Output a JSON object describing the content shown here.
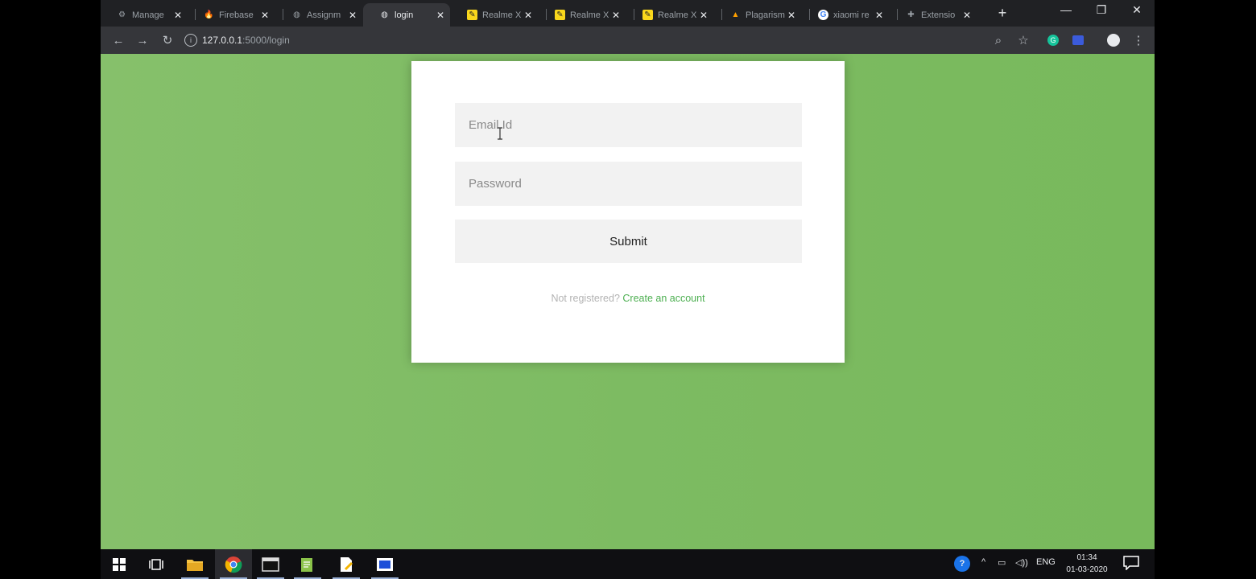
{
  "browser": {
    "tabs": [
      {
        "title": "Manage",
        "icon": "gear-icon",
        "active": false
      },
      {
        "title": "Firebase",
        "icon": "firebase-icon",
        "active": false
      },
      {
        "title": "Assignm",
        "icon": "globe-icon",
        "active": false
      },
      {
        "title": "login",
        "icon": "globe-icon",
        "active": true
      },
      {
        "title": "Realme X",
        "icon": "sticky-note-icon",
        "active": false
      },
      {
        "title": "Realme X",
        "icon": "sticky-note-icon",
        "active": false
      },
      {
        "title": "Realme X",
        "icon": "sticky-note-icon",
        "active": false
      },
      {
        "title": "Plagarism",
        "icon": "firebase-icon",
        "active": false
      },
      {
        "title": "xiaomi re",
        "icon": "google-icon",
        "active": false
      },
      {
        "title": "Extensio",
        "icon": "puzzle-icon",
        "active": false
      }
    ],
    "address": {
      "host": "127.0.0.1",
      "path": ":5000/login"
    }
  },
  "form": {
    "email_placeholder": "Email Id",
    "password_placeholder": "Password",
    "submit_label": "Submit",
    "register_prompt": "Not registered?",
    "register_link": "Create an account"
  },
  "taskbar": {
    "tray_lang": "ENG",
    "clock_time": "01:34",
    "clock_date": "01-03-2020"
  },
  "colors": {
    "page_background": "#7dbb62",
    "link": "#4caf50",
    "field_background": "#f2f2f2"
  }
}
